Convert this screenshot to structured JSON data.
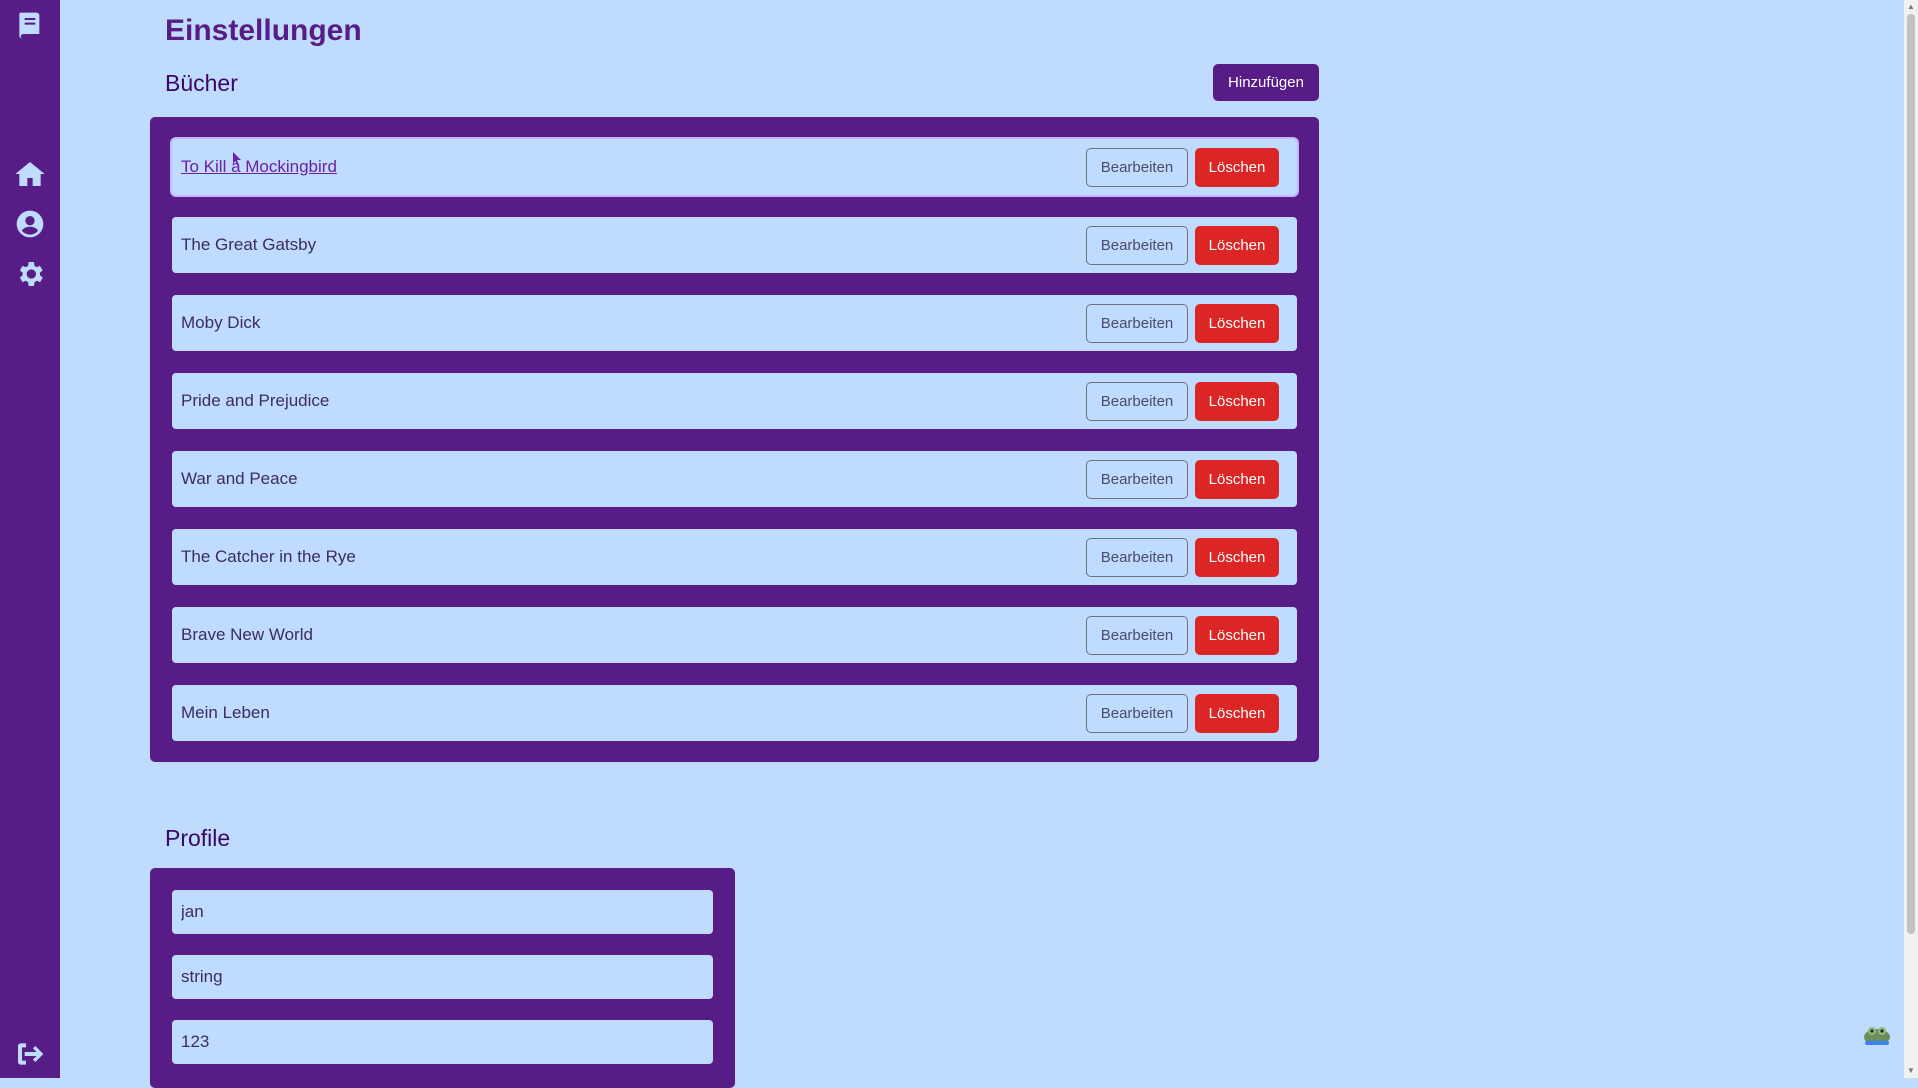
{
  "page": {
    "title": "Einstellungen"
  },
  "sidebar": {
    "icons": [
      "book-icon",
      "home-icon",
      "user-circle-icon",
      "gear-icon",
      "logout-icon"
    ]
  },
  "books": {
    "section_title": "Bücher",
    "add_label": "Hinzufügen",
    "edit_label": "Bearbeiten",
    "delete_label": "Löschen",
    "items": [
      {
        "title": "To Kill a Mockingbird"
      },
      {
        "title": "The Great Gatsby"
      },
      {
        "title": "Moby Dick"
      },
      {
        "title": "Pride and Prejudice"
      },
      {
        "title": "War and Peace"
      },
      {
        "title": "The Catcher in the Rye"
      },
      {
        "title": "Brave New World"
      },
      {
        "title": "Mein Leben"
      }
    ]
  },
  "profile": {
    "section_title": "Profile",
    "fields": [
      {
        "value": "jan"
      },
      {
        "value": "string"
      },
      {
        "value": "123"
      }
    ]
  },
  "colors": {
    "background": "#bfdbfe",
    "sidebar": "#581c87",
    "accent": "#581c87",
    "danger": "#dc2626"
  }
}
